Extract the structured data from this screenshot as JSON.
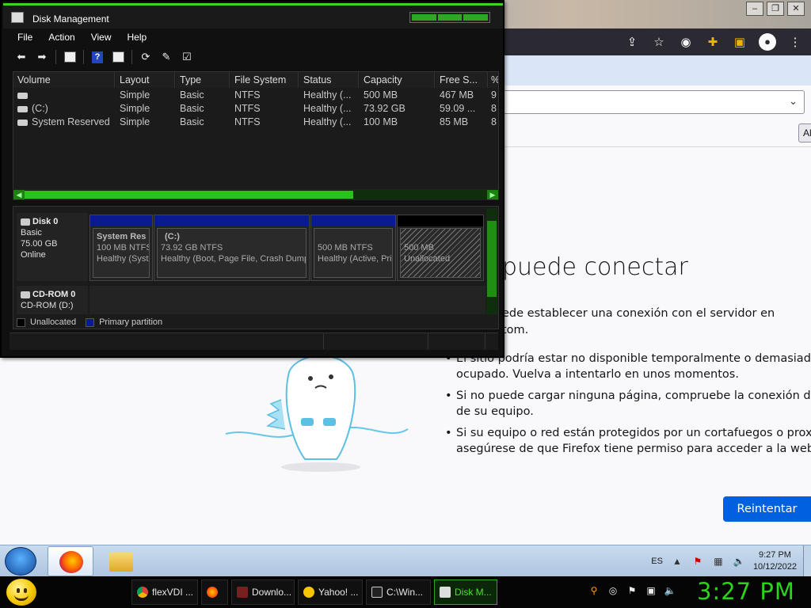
{
  "firefox": {
    "error_title": "puede conectar",
    "error_line1": "ede establecer una conexión con el servidor en",
    "error_line2": "tom.",
    "bullets": [
      "El sitio podría estar no disponible temporalmente o demasiado ocupado. Vuelva a intentarlo en unos momentos.",
      "Si no puede cargar ninguna página, compruebe la conexión de red de su equipo.",
      "Si su equipo o red están protegidos por un cortafuegos o proxy, asegúrese de que Firefox tiene permiso para acceder a la web."
    ],
    "bullet_lines": [
      [
        "El sitio podría estar no disponible temporalmente o demasiado",
        "ocupado. Vuelva a intentarlo en unos momentos."
      ],
      [
        "Si no puede cargar ninguna página, compruebe la conexión de red",
        "de su equipo."
      ],
      [
        "Si su equipo o red están protegidos por un cortafuegos o proxy,",
        "asegúrese de que Firefox tiene permiso para acceder a la web."
      ]
    ],
    "retry_label": "Reintentar",
    "side_button_label": "Al",
    "accent_color": "#0061e0"
  },
  "disk_management": {
    "title": "Disk Management",
    "menu": [
      "File",
      "Action",
      "View",
      "Help"
    ],
    "columns": [
      "Volume",
      "Layout",
      "Type",
      "File System",
      "Status",
      "Capacity",
      "Free S...",
      "%"
    ],
    "rows": [
      {
        "volume": "",
        "layout": "Simple",
        "type": "Basic",
        "fs": "NTFS",
        "status": "Healthy (...",
        "capacity": "500 MB",
        "free": "467 MB",
        "pct": "9"
      },
      {
        "volume": "(C:)",
        "layout": "Simple",
        "type": "Basic",
        "fs": "NTFS",
        "status": "Healthy (...",
        "capacity": "73.92 GB",
        "free": "59.09 ...",
        "pct": "8"
      },
      {
        "volume": "System Reserved",
        "layout": "Simple",
        "type": "Basic",
        "fs": "NTFS",
        "status": "Healthy (...",
        "capacity": "100 MB",
        "free": "85 MB",
        "pct": "8"
      }
    ],
    "disk0": {
      "name": "Disk 0",
      "kind": "Basic",
      "size": "75.00 GB",
      "state": "Online"
    },
    "partitions": [
      {
        "name": "System Res",
        "size": "100 MB NTFS",
        "status": "Healthy (Syst"
      },
      {
        "name": "(C:)",
        "size": "73.92 GB NTFS",
        "status": "Healthy (Boot, Page File, Crash Dump,"
      },
      {
        "name": "",
        "size": "500 MB NTFS",
        "status": "Healthy (Active, Pri"
      },
      {
        "name": "",
        "size": "500 MB",
        "status": "Unallocated"
      }
    ],
    "cdrom": {
      "name": "CD-ROM 0",
      "drive": "CD-ROM (D:)"
    },
    "legend": {
      "unallocated": "Unallocated",
      "primary": "Primary partition"
    },
    "colors": {
      "primary_partition": "#0a1a90",
      "unallocated": "#000000",
      "theme_green": "#2cc01a"
    }
  },
  "win7_taskbar": {
    "language": "ES",
    "time": "9:27 PM",
    "date": "10/12/2022"
  },
  "bottom_taskbar": {
    "tasks": [
      {
        "label": "flexVDI ...",
        "icon": "chrome-icon"
      },
      {
        "label": "",
        "icon": "firefox-icon"
      },
      {
        "label": "Downlo...",
        "icon": "download-icon"
      },
      {
        "label": "Yahoo! ...",
        "icon": "yahoo-icon"
      },
      {
        "label": "C:\\Win...",
        "icon": "cmd-icon"
      },
      {
        "label": "Disk M...",
        "icon": "disk-management-icon"
      }
    ],
    "clock": "3:27 PM",
    "clock_color": "#2cd31a"
  }
}
